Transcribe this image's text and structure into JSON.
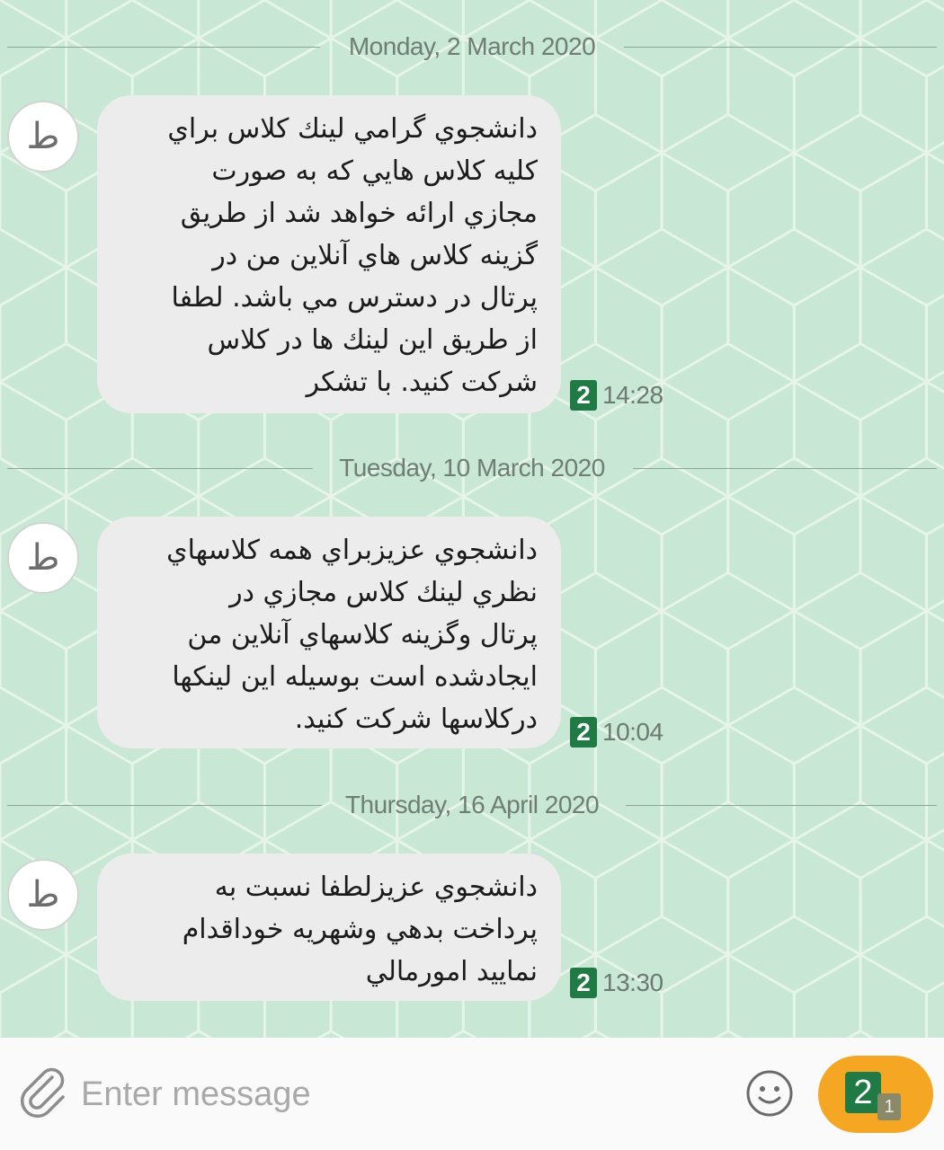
{
  "colors": {
    "chat_background": "#c8e7d4",
    "pattern_line": "#e6f4ea",
    "bubble": "#ececec",
    "sim_badge": "#1f7a44",
    "send_button": "#f5a623"
  },
  "messages": [
    {
      "date": "Monday, 2 March 2020",
      "sender_initial": "ط",
      "text": "دانشجوي گرامي لينك كلاس براي\nكليه كلاس هايي كه به صورت\nمجازي ارائه خواهد شد از طريق\nگزينه كلاس هاي آنلاين من در\nپرتال در دسترس مي باشد. لطفا\nاز طريق اين لينك ها در كلاس\nشركت كنيد. با تشكر",
      "sim": "2",
      "time": "14:28"
    },
    {
      "date": "Tuesday, 10 March 2020",
      "sender_initial": "ط",
      "text": "دانشجوي عزيزبراي همه كلاسهاي\nنظري لينك كلاس مجازي در\nپرتال وگزينه كلاسهاي آنلاين من\nايجادشده است بوسيله اين لينكها\nدركلاسها شركت كنيد.",
      "sim": "2",
      "time": "10:04"
    },
    {
      "date": "Thursday, 16 April 2020",
      "sender_initial": "ط",
      "text": "دانشجوي عزيزلطفا نسبت به\nپرداخت بدهي وشهريه خوداقدام\nنماييد امورمالي",
      "sim": "2",
      "time": "13:30"
    }
  ],
  "composer": {
    "placeholder": "Enter message",
    "attach_icon": "paperclip-icon",
    "emoji_icon": "smiley-icon",
    "send_sim": "2",
    "send_sim_sub": "1"
  }
}
